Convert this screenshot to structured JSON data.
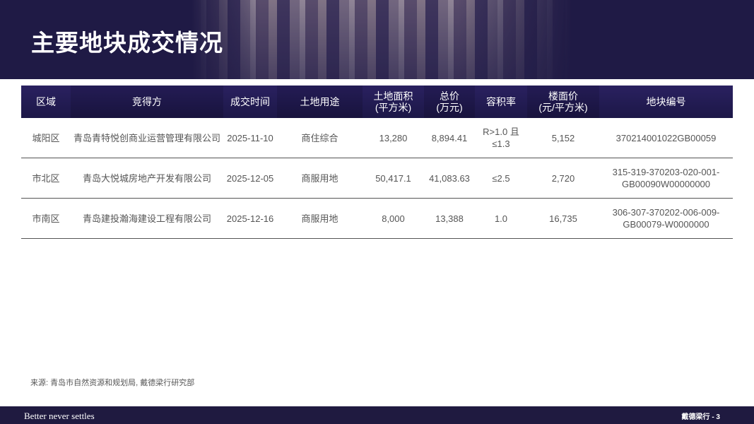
{
  "header": {
    "title": "主要地块成交情况"
  },
  "table": {
    "columns": [
      "区域",
      "竞得方",
      "成交时间",
      "土地用途",
      "土地面积\n(平方米)",
      "总价\n(万元)",
      "容积率",
      "楼面价\n(元/平方米)",
      "地块编号"
    ],
    "rows": [
      [
        "城阳区",
        "青岛青特悦创商业运营管理有限公司",
        "2025-11-10",
        "商住综合",
        "13,280",
        "8,894.41",
        "R>1.0 且\n≤1.3",
        "5,152",
        "370214001022GB00059"
      ],
      [
        "市北区",
        "青岛大悦城房地产开发有限公司",
        "2025-12-05",
        "商服用地",
        "50,417.1",
        "41,083.63",
        "≤2.5",
        "2,720",
        "315-319-370203-020-001-\nGB00090W00000000"
      ],
      [
        "市南区",
        "青岛建投瀚海建设工程有限公司",
        "2025-12-16",
        "商服用地",
        "8,000",
        "13,388",
        "1.0",
        "16,735",
        "306-307-370202-006-009-\nGB00079-W0000000"
      ]
    ]
  },
  "source": "来源: 青岛市自然资源和规划局, 戴德梁行研究部",
  "footer": {
    "tagline": "Better never settles",
    "page": "戴德梁行 - 3"
  }
}
